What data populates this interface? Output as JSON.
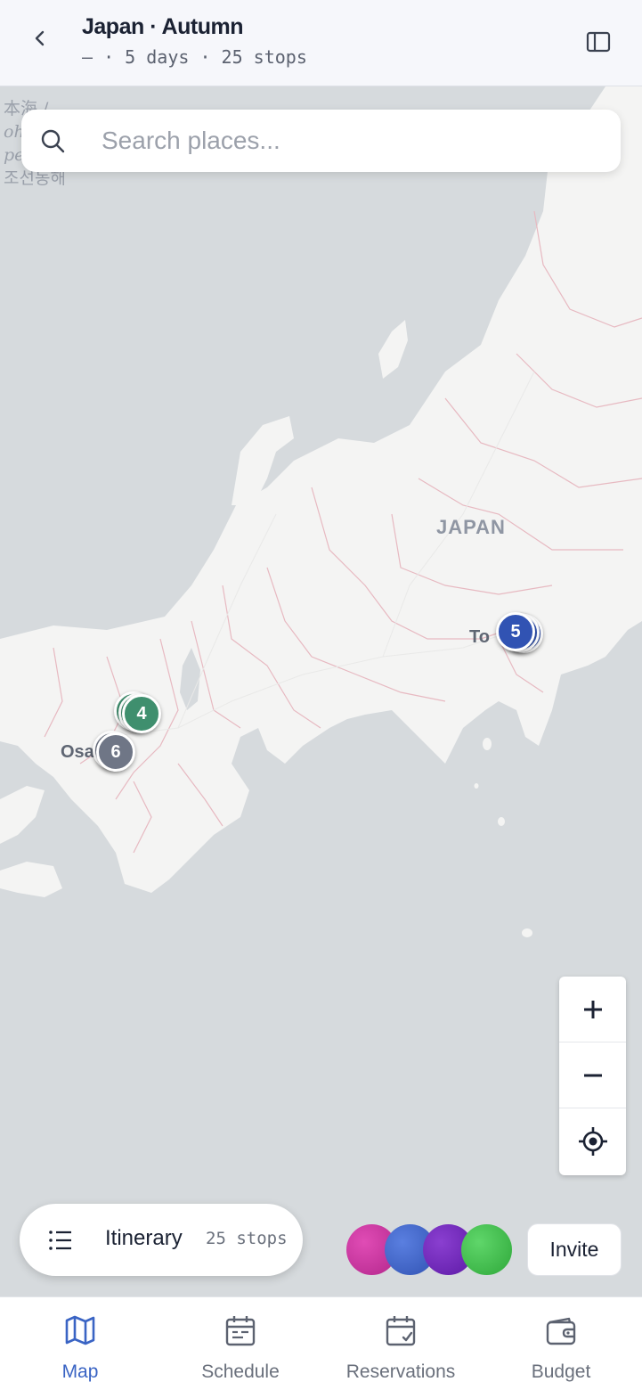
{
  "header": {
    "title": "Japan · Autumn",
    "subtitle": "— · 5 days · 25 stops",
    "back_icon": "chevron-left-icon",
    "panel_icon": "sidebar-panel-icon"
  },
  "search": {
    "placeholder": "Search places..."
  },
  "map": {
    "country_label": "JAPAN",
    "sea_label_lines": [
      "本海 /",
      "oh",
      "pe",
      "조선동해"
    ],
    "city_labels": {
      "osaka": "Osa",
      "tokyo": "To"
    },
    "markers": [
      {
        "label": "4",
        "color": "#3f8f6e"
      },
      {
        "label": "6",
        "color": "#6f7686"
      },
      {
        "label": "5",
        "color": "#3153b3"
      }
    ]
  },
  "zoom": {
    "in_icon": "plus-icon",
    "out_icon": "minus-icon",
    "locate_icon": "crosshair-icon"
  },
  "itinerary": {
    "label": "Itinerary",
    "count": "25 stops"
  },
  "collaborators": [
    {
      "color": "#c2309a"
    },
    {
      "color": "#3d62c4"
    },
    {
      "color": "#6a22b3"
    },
    {
      "color": "#3fbb48"
    }
  ],
  "invite_label": "Invite",
  "bottom_nav": [
    {
      "label": "Map",
      "icon": "map-icon",
      "active": true
    },
    {
      "label": "Schedule",
      "icon": "calendar-icon",
      "active": false
    },
    {
      "label": "Reservations",
      "icon": "calendar-check-icon",
      "active": false
    },
    {
      "label": "Budget",
      "icon": "wallet-icon",
      "active": false
    }
  ],
  "colors": {
    "accent": "#3a64c4",
    "land": "#f4f4f3",
    "water": "#d6dadd",
    "borders": "#e7b9c1"
  }
}
